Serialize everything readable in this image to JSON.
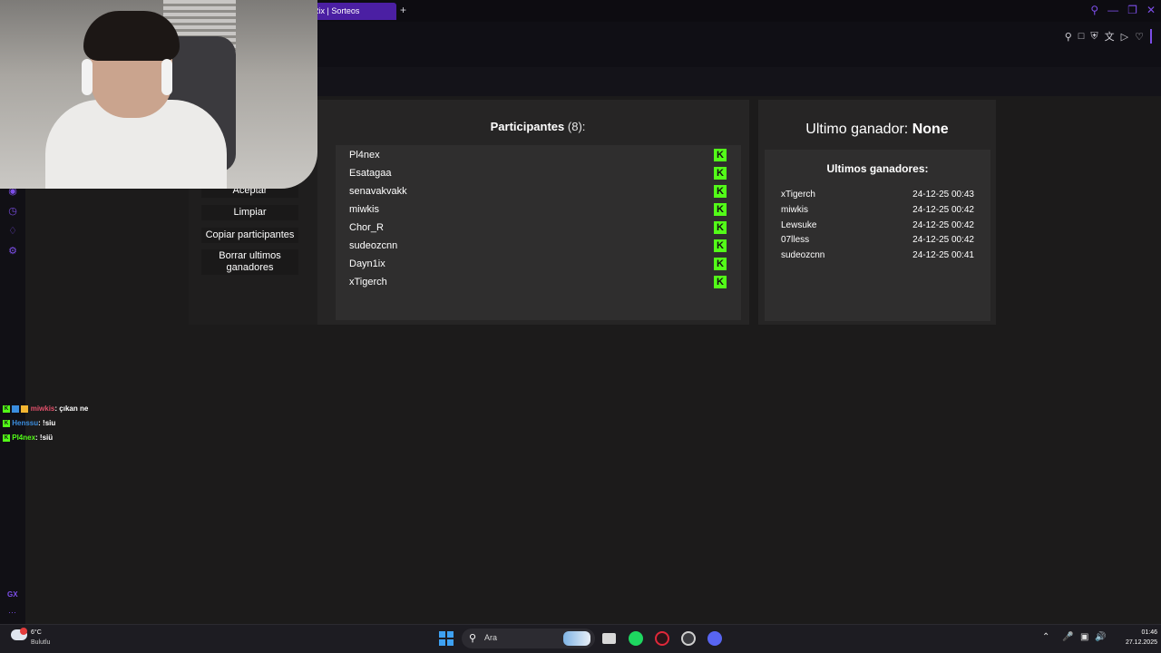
{
  "browser": {
    "active_tab": "Rix | Sorteos",
    "new_tab_glyph": "+"
  },
  "page": {
    "left_buttons": [
      "Aceptar",
      "Limpiar",
      "Copiar participantes",
      "Borrar ultimos ganadores"
    ],
    "participants_title": "Participantes",
    "participants_count": "(8):",
    "participants": [
      "Pl4nex",
      "Esatagaa",
      "senavakvakk",
      "miwkis",
      "Chor_R",
      "sudeozcnn",
      "Dayn1ix",
      "xTigerch"
    ],
    "platform_badge": "K",
    "last_winner_label": "Ultimo ganador:",
    "last_winner_value": "None",
    "winners_title": "Ultimos ganadores:",
    "winners": [
      {
        "name": "xTigerch",
        "date": "24-12-25 00:43"
      },
      {
        "name": "miwkis",
        "date": "24-12-25 00:42"
      },
      {
        "name": "Lewsuke",
        "date": "24-12-25 00:42"
      },
      {
        "name": "07lless",
        "date": "24-12-25 00:42"
      },
      {
        "name": "sudeozcnn",
        "date": "24-12-25 00:41"
      }
    ]
  },
  "chat": [
    {
      "user": "miwkis",
      "message": ": çıkan ne",
      "color": "#e0506a"
    },
    {
      "user": "Henssu",
      "message": ": !siu",
      "color": "#3a8dde"
    },
    {
      "user": "Pl4nex",
      "message": ": !siü",
      "color": "#53fc18"
    }
  ],
  "sidebar": {
    "gx_label": "GX",
    "more_label": "···"
  },
  "taskbar": {
    "temperature": "6°C",
    "weather": "Bulutlu",
    "search_label": "Ara",
    "time": "01:46",
    "date": "27.12.2025"
  },
  "colors": {
    "accent": "#7c4ee8",
    "kick_green": "#53fc18"
  }
}
